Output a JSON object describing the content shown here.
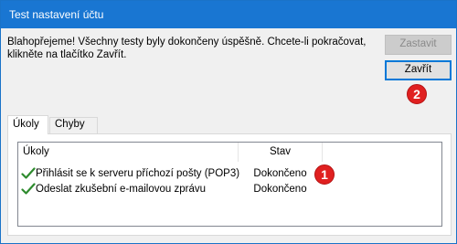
{
  "window": {
    "title": "Test nastavení účtu"
  },
  "message": {
    "line1": "Blahopřejeme! Všechny testy byly dokončeny úspěšně. Chcete-li pokračovat,",
    "line2": "klikněte na tlačítko Zavřít."
  },
  "buttons": {
    "stop_label": "Zastavit",
    "close_label": "Zavřít"
  },
  "badges": {
    "first": "1",
    "second": "2"
  },
  "tabs": [
    {
      "label": "Úkoly",
      "active": true
    },
    {
      "label": "Chyby",
      "active": false
    }
  ],
  "table": {
    "headers": {
      "tasks": "Úkoly",
      "status": "Stav"
    },
    "rows": [
      {
        "task": "Přihlásit se k serveru příchozí pošty (POP3)",
        "status": "Dokončeno"
      },
      {
        "task": "Odeslat zkušební e-mailovou zprávu",
        "status": "Dokončeno"
      }
    ]
  },
  "colors": {
    "titlebar": "#1976d2",
    "accent": "#0078d7",
    "badge": "#e02020",
    "check": "#2e8b2e"
  },
  "icons": {
    "row_check": "checkmark-icon"
  }
}
